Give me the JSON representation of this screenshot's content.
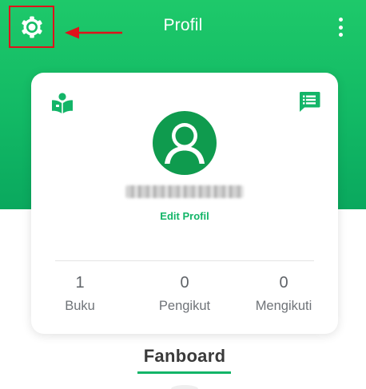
{
  "header": {
    "title": "Profil",
    "settings_icon": "gear-icon",
    "menu_icon": "more-vert-icon",
    "bg_color": "#12b965"
  },
  "annotation": {
    "highlight_color": "#e0121a",
    "points_to": "settings-button"
  },
  "profile_card": {
    "left_icon": "book-reader-icon",
    "right_icon": "chat-list-icon",
    "avatar_icon": "user-avatar-icon",
    "username_obscured": true,
    "edit_label": "Edit Profil",
    "stats": [
      {
        "value": "1",
        "label": "Buku"
      },
      {
        "value": "0",
        "label": "Pengikut"
      },
      {
        "value": "0",
        "label": "Mengikuti"
      }
    ]
  },
  "tabs": {
    "active_label": "Fanboard",
    "accent_color": "#13b568"
  }
}
